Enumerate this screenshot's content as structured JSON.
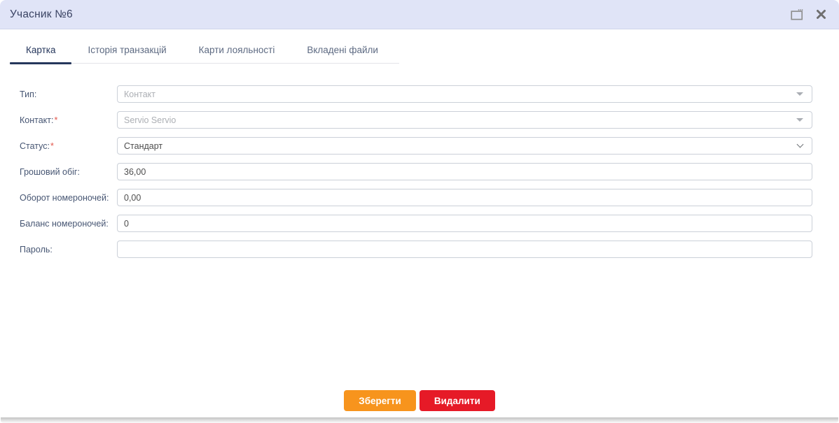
{
  "window": {
    "title": "Учасник №6"
  },
  "header_icons": [
    {
      "name": "maximize-icon"
    },
    {
      "name": "close-icon"
    }
  ],
  "tabs": [
    {
      "label": "Картка",
      "active": true
    },
    {
      "label": "Історія транзакцій",
      "active": false
    },
    {
      "label": "Карти лояльності",
      "active": false
    },
    {
      "label": "Вкладені файли",
      "active": false
    }
  ],
  "form": {
    "fields": [
      {
        "name": "type-select",
        "label": "Тип:",
        "required": false,
        "type": "select",
        "disabled": true,
        "value": "Контакт"
      },
      {
        "name": "contact-select",
        "label": "Контакт:",
        "required": true,
        "type": "select",
        "disabled": true,
        "value": "Servio Servio"
      },
      {
        "name": "status-select",
        "label": "Статус:",
        "required": true,
        "type": "select",
        "disabled": false,
        "value": "Стандарт"
      },
      {
        "name": "cash-turnover-input",
        "label": "Грошовий обіг:",
        "required": false,
        "type": "text",
        "disabled": false,
        "value": "36,00"
      },
      {
        "name": "room-nights-turnover-input",
        "label": "Оборот номероночей:",
        "required": false,
        "type": "text",
        "disabled": false,
        "value": "0,00"
      },
      {
        "name": "room-nights-balance-input",
        "label": "Баланс номероночей:",
        "required": false,
        "type": "text",
        "disabled": false,
        "value": "0"
      },
      {
        "name": "password-input",
        "label": "Пароль:",
        "required": false,
        "type": "text",
        "disabled": false,
        "value": ""
      }
    ]
  },
  "buttons": {
    "save": "Зберегти",
    "delete": "Видалити"
  },
  "colors": {
    "header_bg": "#e0e4f7",
    "title_text": "#3a4363",
    "tab_active": "#26375c",
    "tab_inactive": "#5d6a82",
    "label_text": "#475673",
    "required_star": "#e2574c",
    "input_border": "#cbd0d8",
    "input_text": "#4d4d4d",
    "disabled_text": "#acafb4",
    "save_button_bg": "#f7941d",
    "delete_button_bg": "#e61a27"
  }
}
